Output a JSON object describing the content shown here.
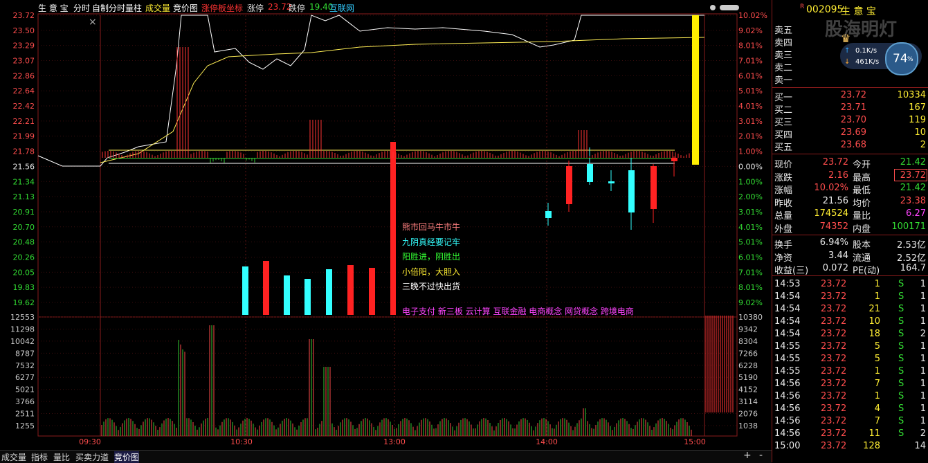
{
  "topbar": {
    "stock_name": "生 意 宝",
    "items": [
      "分时",
      "自制分时量柱",
      "成交量",
      "竞价图"
    ],
    "limit_label": "涨停板坐标",
    "up_label": "涨停",
    "up_value": "23.72",
    "down_label": "跌停",
    "down_value": "19.40",
    "sector": "互联网"
  },
  "price_axis_left": [
    "23.72",
    "23.50",
    "23.29",
    "23.07",
    "22.86",
    "22.64",
    "22.42",
    "22.21",
    "21.99",
    "21.78",
    "21.56",
    "21.34",
    "21.13",
    "20.91",
    "20.70",
    "20.48",
    "20.26",
    "20.05",
    "19.83",
    "19.62"
  ],
  "pct_axis_right": [
    "10.02%",
    "9.02%",
    "8.01%",
    "7.01%",
    "6.01%",
    "5.01%",
    "4.01%",
    "3.01%",
    "2.01%",
    "1.00%",
    "0.00%",
    "1.00%",
    "2.00%",
    "3.01%",
    "4.01%",
    "5.01%",
    "6.01%",
    "7.01%",
    "8.01%",
    "9.02%"
  ],
  "vol_axis_left": [
    "12553",
    "11298",
    "10042",
    "8787",
    "7532",
    "6277",
    "5021",
    "3766",
    "2511",
    "1255"
  ],
  "vol_axis_right": [
    "10380",
    "9342",
    "8304",
    "7266",
    "6228",
    "5190",
    "4152",
    "3114",
    "2076",
    "1038"
  ],
  "time_labels": [
    "09:30",
    "10:30",
    "13:00",
    "14:00",
    "15:00"
  ],
  "annotations": [
    {
      "text": "熊市回马牛市牛",
      "color": "#ff8080"
    },
    {
      "text": "九阴真经要记牢",
      "color": "#33ffff"
    },
    {
      "text": "阳胜进，阴胜出",
      "color": "#33ff33"
    },
    {
      "text": "小倍阳，大胆入",
      "color": "#ffee33"
    },
    {
      "text": "三晚不过快出货",
      "color": "#ffffff"
    }
  ],
  "concepts": "电子支付 新三板 云计算 互联金融 电商概念 网贷概念 跨境电商",
  "tabs": [
    "成交量",
    "指标",
    "量比",
    "买卖力道",
    "竞价图"
  ],
  "active_tab": "竞价图",
  "right": {
    "flag": "R",
    "code": "002095",
    "name": "生 意 宝",
    "watermark": "股海明灯",
    "speed_up": "0.1K/s",
    "speed_down": "461K/s",
    "gauge": "74",
    "gauge_unit": "%",
    "asks": [
      {
        "label": "卖五",
        "price": "",
        "vol": ""
      },
      {
        "label": "卖四",
        "price": "",
        "vol": ""
      },
      {
        "label": "卖三",
        "price": "",
        "vol": ""
      },
      {
        "label": "卖二",
        "price": "",
        "vol": ""
      },
      {
        "label": "卖一",
        "price": "",
        "vol": ""
      }
    ],
    "bids": [
      {
        "label": "买一",
        "price": "23.72",
        "vol": "10334"
      },
      {
        "label": "买二",
        "price": "23.71",
        "vol": "167"
      },
      {
        "label": "买三",
        "price": "23.70",
        "vol": "119"
      },
      {
        "label": "买四",
        "price": "23.69",
        "vol": "10"
      },
      {
        "label": "买五",
        "price": "23.68",
        "vol": "2"
      }
    ],
    "stats": [
      {
        "l1": "现价",
        "v1": "23.72",
        "c1": "red",
        "l2": "今开",
        "v2": "21.42",
        "c2": "green"
      },
      {
        "l1": "涨跌",
        "v1": "2.16",
        "c1": "red",
        "l2": "最高",
        "v2": "23.72",
        "c2": "red"
      },
      {
        "l1": "涨幅",
        "v1": "10.02%",
        "c1": "red",
        "l2": "最低",
        "v2": "21.42",
        "c2": "green"
      },
      {
        "l1": "昨收",
        "v1": "21.56",
        "c1": "white",
        "l2": "均价",
        "v2": "23.38",
        "c2": "red"
      },
      {
        "l1": "总量",
        "v1": "174524",
        "c1": "yellow",
        "l2": "量比",
        "v2": "6.27",
        "c2": "magenta"
      },
      {
        "l1": "外盘",
        "v1": "74352",
        "c1": "red",
        "l2": "内盘",
        "v2": "100171",
        "c2": "green"
      }
    ],
    "stats2": [
      {
        "l1": "换手",
        "v1": "6.94%",
        "l2": "股本",
        "v2": "2.53亿"
      },
      {
        "l1": "净资",
        "v1": "3.44",
        "l2": "流通",
        "v2": "2.52亿"
      },
      {
        "l1": "收益(三)",
        "v1": "0.072",
        "l2": "PE(动)",
        "v2": "164.7"
      }
    ],
    "ticks": [
      {
        "t": "14:53",
        "p": "23.72",
        "v": "1",
        "d": "S",
        "n": "1"
      },
      {
        "t": "14:54",
        "p": "23.72",
        "v": "1",
        "d": "S",
        "n": "1"
      },
      {
        "t": "14:54",
        "p": "23.72",
        "v": "21",
        "d": "S",
        "n": "1"
      },
      {
        "t": "14:54",
        "p": "23.72",
        "v": "10",
        "d": "S",
        "n": "1"
      },
      {
        "t": "14:54",
        "p": "23.72",
        "v": "18",
        "d": "S",
        "n": "2"
      },
      {
        "t": "14:55",
        "p": "23.72",
        "v": "5",
        "d": "S",
        "n": "1"
      },
      {
        "t": "14:55",
        "p": "23.72",
        "v": "5",
        "d": "S",
        "n": "1"
      },
      {
        "t": "14:55",
        "p": "23.72",
        "v": "1",
        "d": "S",
        "n": "1"
      },
      {
        "t": "14:56",
        "p": "23.72",
        "v": "7",
        "d": "S",
        "n": "1"
      },
      {
        "t": "14:56",
        "p": "23.72",
        "v": "1",
        "d": "S",
        "n": "1"
      },
      {
        "t": "14:56",
        "p": "23.72",
        "v": "4",
        "d": "S",
        "n": "1"
      },
      {
        "t": "14:56",
        "p": "23.72",
        "v": "7",
        "d": "S",
        "n": "1"
      },
      {
        "t": "14:56",
        "p": "23.72",
        "v": "11",
        "d": "S",
        "n": "2"
      },
      {
        "t": "15:00",
        "p": "23.72",
        "v": "128",
        "d": "",
        "n": "14"
      }
    ]
  },
  "colors": {
    "up": "#ff3333",
    "down": "#33cc33",
    "cyan": "#33ffff",
    "frame": "#8a1b1b",
    "price_line": "#ffffff",
    "avg_line": "#ffee55"
  }
}
